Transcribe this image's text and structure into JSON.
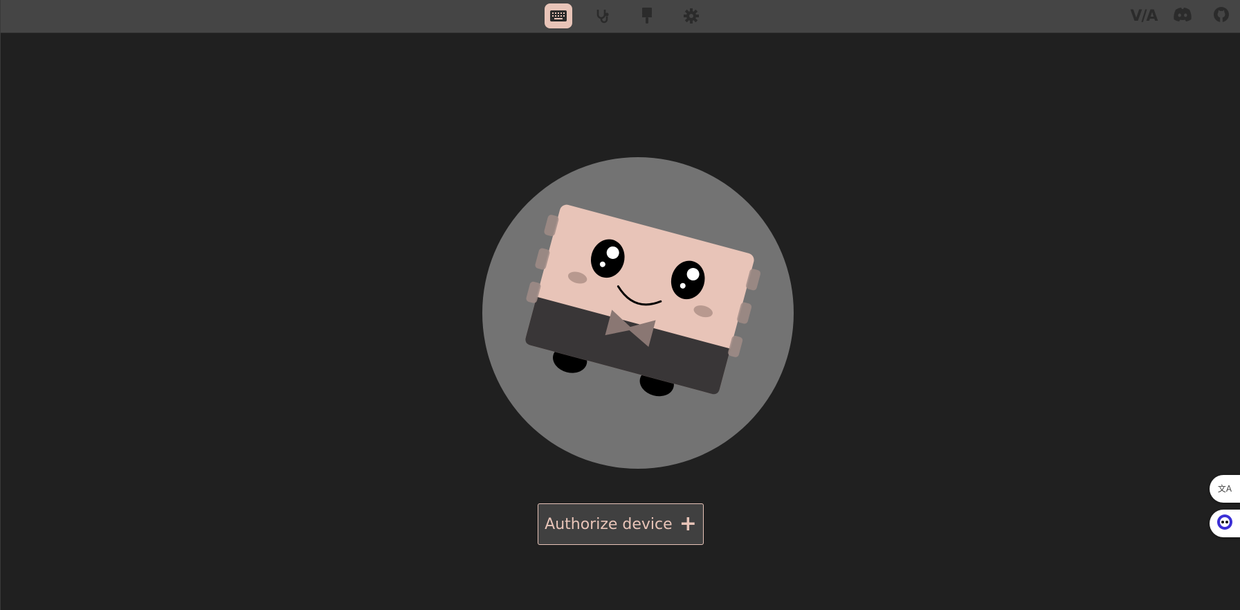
{
  "nav": {
    "items": [
      {
        "id": "configure",
        "icon": "keyboard-icon",
        "active": true
      },
      {
        "id": "test",
        "icon": "stethoscope-icon",
        "active": false
      },
      {
        "id": "design",
        "icon": "paintbrush-icon",
        "active": false
      },
      {
        "id": "settings",
        "icon": "gear-icon",
        "active": false
      }
    ]
  },
  "header_right": {
    "via_logo": "V/A",
    "discord_icon": "discord-icon",
    "github_icon": "github-icon"
  },
  "main": {
    "mascot_icon": "keyboard-mascot-icon",
    "authorize_label": "Authorize device",
    "authorize_icon": "plus-icon",
    "authorize_plus": "+"
  },
  "floating": {
    "translate_icon": "translate-icon",
    "translate_glyph": "文A",
    "assistant_icon": "assistant-icon"
  },
  "colors": {
    "background": "#202020",
    "topbar": "#454545",
    "accent": "#e8c4b8",
    "nav_icon": "#2b2b2b",
    "mascot_circle": "#737373",
    "button_bg": "#404040"
  }
}
